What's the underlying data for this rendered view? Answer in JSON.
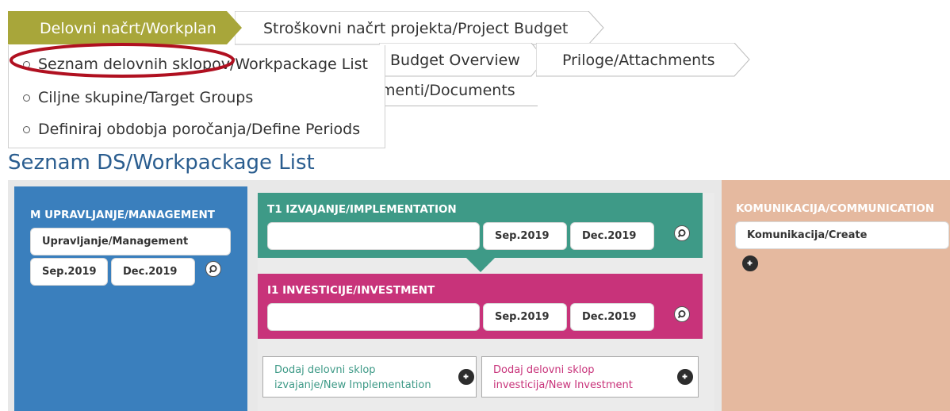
{
  "tabs": {
    "workplan": "Delovni načrt/Workplan",
    "budget": "Stroškovni načrt projekta/Project Budget",
    "budget_overview": "Budget Overview",
    "attachments": "Priloge/Attachments",
    "documents": "menti/Documents"
  },
  "dropdown": {
    "items": [
      "Seznam delovnih sklopov/Workpackage List",
      "Ciljne skupine/Target Groups",
      "Definiraj obdobja poročanja/Define Periods"
    ]
  },
  "page_title": "Seznam DS/Workpackage List",
  "management": {
    "header": "M UPRAVLJANJE/MANAGEMENT",
    "name": "Upravljanje/Management",
    "start": "Sep.2019",
    "end": "Dec.2019"
  },
  "implementation": {
    "header": "T1 IZVAJANJE/IMPLEMENTATION",
    "name": "",
    "start": "Sep.2019",
    "end": "Dec.2019"
  },
  "investment": {
    "header": "I1 INVESTICIJE/INVESTMENT",
    "name": "",
    "start": "Sep.2019",
    "end": "Dec.2019"
  },
  "add_implementation": {
    "line1": "Dodaj delovni sklop",
    "line2": "izvajanje/New Implementation"
  },
  "add_investment": {
    "line1": "Dodaj delovni sklop",
    "line2": "investicija/New Investment"
  },
  "communication": {
    "header": "KOMUNIKACIJA/COMMUNICATION",
    "name": "Komunikacija/Create"
  },
  "colors": {
    "workplan_tab": "#a8a63a",
    "management": "#3a7fbd",
    "implementation": "#3e9a87",
    "investment": "#c8337a",
    "communication": "#e5b99f",
    "title": "#2a5d8f",
    "highlight": "#b01020"
  },
  "icons": {
    "zoom": "magnifier-icon",
    "add": "plus-circle-icon",
    "bullet": "circle-bullet-icon"
  }
}
